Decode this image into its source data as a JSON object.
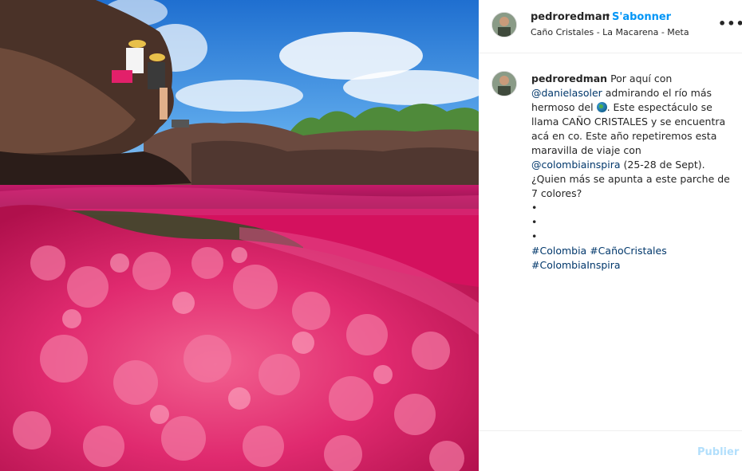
{
  "post": {
    "username": "pedroredman",
    "separator": "•",
    "follow_label": "S'abonner",
    "location": "Caño Cristales - La Macarena - Meta",
    "more_label": "•••"
  },
  "caption": {
    "username": "pedroredman",
    "text_1": "Por aquí con",
    "mention_1": "@danielasoler",
    "text_2": "admirando el río más hermoso del",
    "text_3": ". Este espectáculo se llama CAÑO CRISTALES y se encuentra acá en co. Este año repetiremos esta maravilla de viaje con",
    "mention_2": "@colombiainspira",
    "text_4": "(25-28 de Sept). ¿Quien más se apunta a este parche de 7 colores?",
    "bullets": [
      "•",
      "•",
      "•"
    ],
    "hashtag_1": "#Colombia",
    "hashtag_2": "#CañoCristales",
    "hashtag_3": "#ColombiaInspira"
  },
  "comment": {
    "publish_label": "Publier"
  },
  "colors": {
    "accent": "#0095f6",
    "link": "#00376b",
    "publish_disabled": "#b2dffc",
    "river_pink": "#d4115e"
  },
  "icons": {
    "globe": "globe-emoji-icon",
    "more": "more-options-icon"
  }
}
